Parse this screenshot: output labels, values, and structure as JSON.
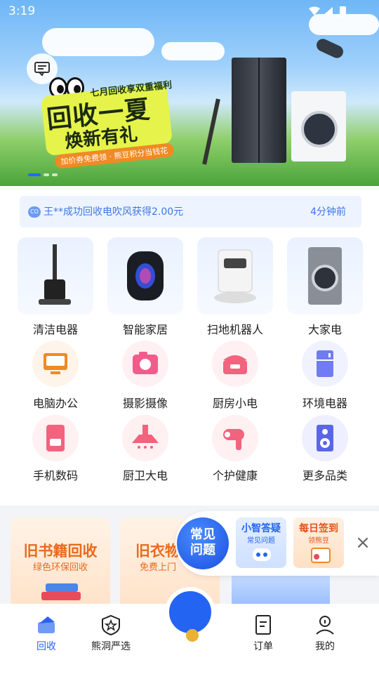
{
  "status_bar": {
    "time": "3:19"
  },
  "banner": {
    "subtitle": "七月回收享双重福利",
    "title_line1": "回收一夏",
    "title_line2": "焕新有礼",
    "tag": "加价券免费领 · 熊豆积分当钱花"
  },
  "notice": {
    "text": "王**成功回收电吹风获得2.00元",
    "time": "4分钟前"
  },
  "big_categories": [
    "清洁电器",
    "智能家居",
    "扫地机器人",
    "大家电"
  ],
  "small_categories": [
    "电脑办公",
    "摄影摄像",
    "厨房小电",
    "环境电器",
    "手机数码",
    "厨卫大电",
    "个护健康",
    "更多品类"
  ],
  "promo_cards": [
    {
      "title": "旧书籍回收",
      "sub": "绿色环保回收"
    },
    {
      "title": "旧衣物",
      "sub": "免费上门"
    }
  ],
  "float_bar": {
    "faq": "常见问题",
    "cards": [
      {
        "title": "小智答疑",
        "sub": "常见问题"
      },
      {
        "title": "每日签到",
        "sub": "领熊豆"
      }
    ]
  },
  "tabs": [
    {
      "label": "回收",
      "icon": "home-icon",
      "active": true
    },
    {
      "label": "熊洞严选",
      "icon": "star-badge-icon",
      "active": false
    },
    {
      "label": "订单",
      "icon": "order-icon",
      "active": false
    },
    {
      "label": "我的",
      "icon": "profile-icon",
      "active": false
    }
  ],
  "colors": {
    "accent": "#2464f2",
    "notice_bg": "#edf4ff",
    "promo_orange": "#ea6a1c"
  }
}
